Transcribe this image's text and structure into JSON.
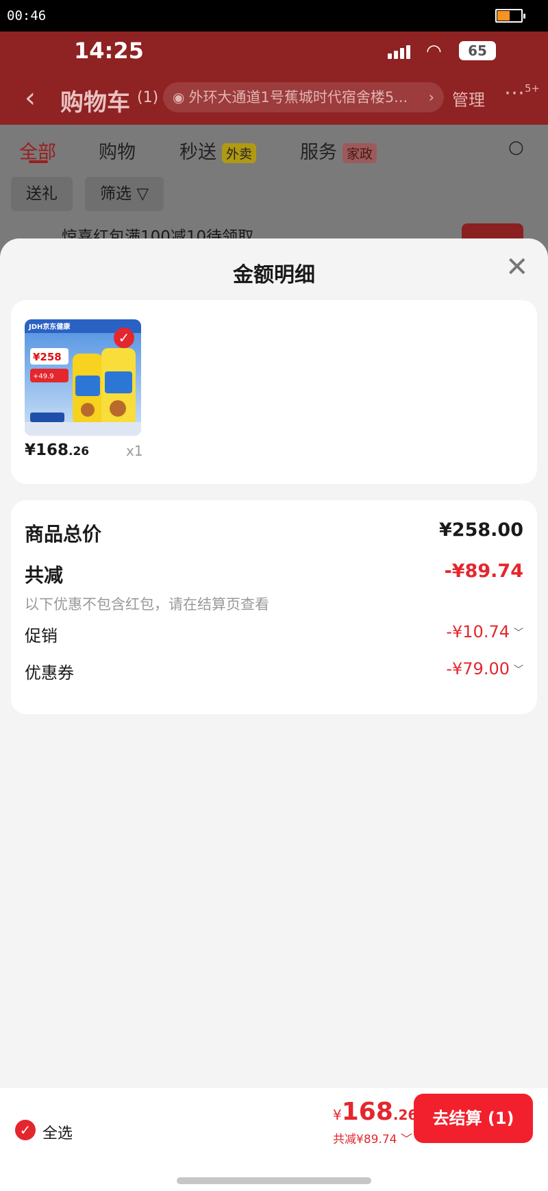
{
  "system_bar": {
    "clock": "00:46"
  },
  "ios_status": {
    "time": "14:25",
    "battery": "65"
  },
  "navbar": {
    "back": "‹",
    "title": "购物车",
    "count": "(1)",
    "address": "外环大通道1号蕉城时代宿舍楼5...",
    "manage": "管理",
    "more_badge": "5+"
  },
  "tabs": [
    {
      "label": "全部"
    },
    {
      "label": "购物"
    },
    {
      "label": "秒送",
      "tag": "外卖"
    },
    {
      "label": "服务",
      "tag": "家政"
    }
  ],
  "chips": {
    "gift": "送礼",
    "filter": "筛选"
  },
  "redpack": {
    "text": "惊喜红包满100减10待领取"
  },
  "sheet": {
    "title": "金额明细",
    "product": {
      "price_main": "¥168",
      "price_decimal": ".26",
      "qty": "x1",
      "brand": "JDH京东健康"
    },
    "detail": {
      "total_label": "商品总价",
      "total_value": "¥258.00",
      "discount_label": "共减",
      "discount_value": "-¥89.74",
      "note": "以下优惠不包含红包，请在结算页查看",
      "promo_label": "促销",
      "promo_value": "-¥10.74",
      "coupon_label": "优惠券",
      "coupon_value": "-¥79.00"
    }
  },
  "bottom": {
    "select_all": "全选",
    "total_yen": "¥",
    "total_main": "168",
    "total_decimal": ".26",
    "saved": "共减¥89.74",
    "checkout": "去结算 (1)"
  },
  "colors": {
    "accent": "#e4262d",
    "checkout": "#f2202c",
    "sheet_bg": "#f4f4f5"
  }
}
